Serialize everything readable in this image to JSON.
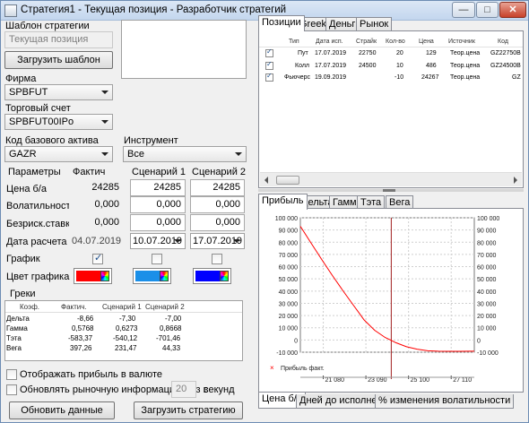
{
  "window": {
    "title": "Стратегия1 - Текущая позиция - Разработчик стратегий",
    "controls": {
      "minimize": "—",
      "maximize": "□",
      "close": "✕"
    }
  },
  "left": {
    "template_label": "Шаблон стратегии",
    "template_value": "Текущая позиция",
    "load_template_button": "Загрузить шаблон",
    "firm_label": "Фирма",
    "firm_value": "SPBFUT",
    "account_label": "Торговый счет",
    "account_value": "SPBFUT00IPo",
    "base_asset_label": "Код базового актива",
    "base_asset_value": "GAZR",
    "instrument_label": "Инструмент",
    "instrument_value": "Все",
    "params": {
      "header_params": "Параметры",
      "header_fact": "Фактич",
      "header_s1": "Сценарий 1",
      "header_s2": "Сценарий 2",
      "price_label": "Цена б/а",
      "price_fact": "24285",
      "price_s1": "24285",
      "price_s2": "24285",
      "vol_label": "Волатильность",
      "vol_fact": "0,000",
      "vol_s1": "0,000",
      "vol_s2": "0,000",
      "rate_label": "Безриск.ставка",
      "rate_fact": "0,000",
      "rate_s1": "0,000",
      "rate_s2": "0,000",
      "date_label": "Дата расчета",
      "date_fact": "04.07.2019",
      "date_s1": "10.07.2019",
      "date_s2": "17.07.2019",
      "chart_label": "График",
      "chart_color_label": "Цвет графика",
      "color_fact": "#ff0000",
      "color_s1": "#1a8fe8",
      "color_s2": "#0000ff"
    },
    "greeks": {
      "title": "Греки",
      "headers": [
        "Коэф.",
        "Фактич.",
        "Сценарий 1",
        "Сценарий 2"
      ],
      "rows": [
        [
          "Дельта",
          "-8,66",
          "-7,30",
          "-7,00"
        ],
        [
          "Гамма",
          "0,5768",
          "0,6273",
          "0,8668"
        ],
        [
          "Тэта",
          "-583,37",
          "-540,12",
          "-701,46"
        ],
        [
          "Вега",
          "397,26",
          "231,47",
          "44,33"
        ]
      ]
    },
    "show_profit_currency": "Отображать прибыль в валюте",
    "refresh_label": "Обновлять рыночную информацию раз в",
    "refresh_value": "20",
    "refresh_unit": "секунд",
    "refresh_data_button": "Обновить данные",
    "load_strategy_button": "Загрузить стратегию"
  },
  "top_tabs": [
    "Позиции",
    "Greeks",
    "Деньги",
    "Рынок"
  ],
  "positions": {
    "headers": [
      "Тип",
      "Дата исп.",
      "Страйк",
      "Кол-во",
      "Цена",
      "Источник",
      "Код"
    ],
    "rows": [
      [
        "Пут",
        "17.07.2019",
        "22750",
        "20",
        "129",
        "Теор.цена",
        "GZ22750B"
      ],
      [
        "Колл",
        "17.07.2019",
        "24500",
        "10",
        "486",
        "Теор.цена",
        "GZ24500B"
      ],
      [
        "Фьючерс",
        "19.09.2019",
        "",
        "-10",
        "24267",
        "Теор.цена",
        "GZ"
      ]
    ]
  },
  "chart_tabs": [
    "Прибыль",
    "Дельта",
    "Гамма",
    "Тэта",
    "Вега"
  ],
  "bottom_tabs": [
    "Цена б/а",
    "Дней до исполнения",
    "% изменения волатильности"
  ],
  "chart_data": {
    "type": "line",
    "title": "",
    "xlabel": "",
    "ylabel": "",
    "xlim": [
      20000,
      28200
    ],
    "ylim": [
      -10000,
      100000
    ],
    "x_ticks": [
      "21 080",
      "23 090",
      "25 100",
      "27 110"
    ],
    "x_tick_values": [
      21080,
      23090,
      25100,
      27110
    ],
    "y_ticks": [
      "100 000",
      "90 000",
      "80 000",
      "70 000",
      "60 000",
      "50 000",
      "40 000",
      "30 000",
      "20 000",
      "10 000",
      "0",
      "-10 000"
    ],
    "y_tick_values": [
      100000,
      90000,
      80000,
      70000,
      60000,
      50000,
      40000,
      30000,
      20000,
      10000,
      0,
      -10000
    ],
    "grid": true,
    "legend_position": "bottom-left",
    "marker_line_x": 24285,
    "series": [
      {
        "name": "Прибыль факт.",
        "color": "#ff0000",
        "x": [
          20000,
          20500,
          21000,
          21500,
          22000,
          22500,
          22750,
          23000,
          23500,
          24000,
          24285,
          24500,
          25000,
          25500,
          26000,
          26500,
          27000,
          27500,
          28000,
          28200
        ],
        "values": [
          93000,
          79500,
          66000,
          53000,
          40500,
          28500,
          22500,
          16500,
          8000,
          2000,
          -300,
          -2200,
          -5500,
          -7500,
          -8800,
          -9200,
          -9300,
          -9300,
          -9200,
          -9200
        ]
      }
    ]
  }
}
